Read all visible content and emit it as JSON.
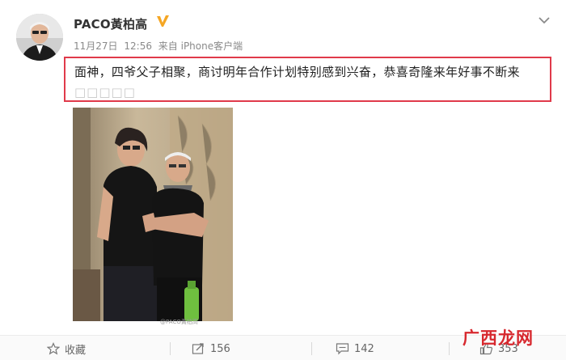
{
  "post": {
    "username": "PACO黃柏高",
    "date": "11月27日",
    "time": "12:56",
    "source": "来自 iPhone客户端",
    "text": "面神，四爷父子相聚，商讨明年合作计划特别感到兴奋，恭喜奇隆来年好事不断来",
    "text_tail": "□□□□□",
    "photo_watermark": "@PACO黃柏高"
  },
  "actions": {
    "favorite": "收藏",
    "repost_count": "156",
    "comment_count": "142",
    "like_count": "353"
  },
  "site_logo": "广西龙网",
  "colors": {
    "highlight_border": "#e03a4a",
    "verified_badge": "#f5a623",
    "logo": "#d7282e"
  },
  "icons": [
    "verified-badge-icon",
    "chevron-down-icon",
    "star-icon",
    "repost-icon",
    "comment-icon",
    "thumbs-up-icon"
  ]
}
